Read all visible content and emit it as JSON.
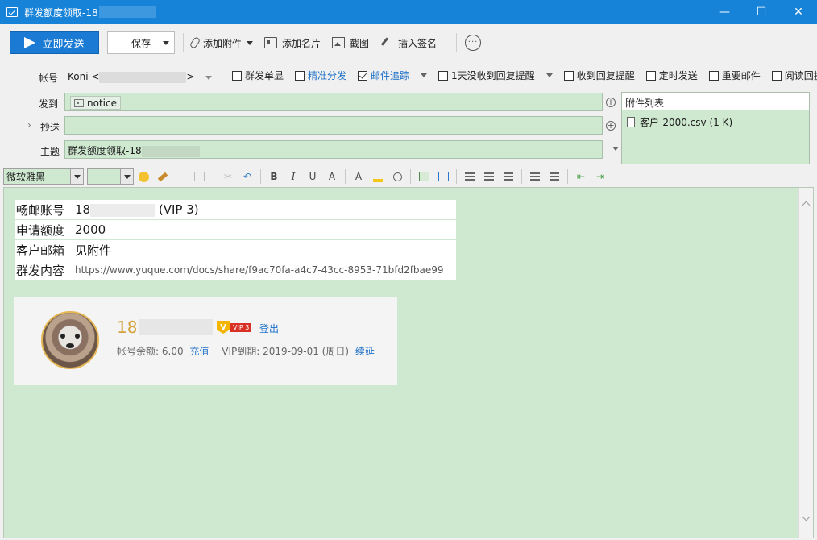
{
  "window": {
    "title": "群发额度领取-18",
    "minimize": "—",
    "maximize": "☐",
    "close": "✕"
  },
  "toolbar": {
    "send_label": "立即发送",
    "save_label": "保存",
    "attach_label": "添加附件",
    "card_label": "添加名片",
    "screenshot_label": "截图",
    "signature_label": "插入签名",
    "more_label": "···"
  },
  "header": {
    "account_label": "帐号",
    "account_value": "Koni <",
    "account_end": ">",
    "options": [
      {
        "label": "群发单显",
        "checked": false,
        "highlight": false
      },
      {
        "label": "精准分发",
        "checked": false,
        "highlight": true
      },
      {
        "label": "邮件追踪",
        "checked": true,
        "highlight": true
      },
      {
        "label": "1天没收到回复提醒",
        "checked": false,
        "highlight": false
      },
      {
        "label": "收到回复提醒",
        "checked": false,
        "highlight": false
      },
      {
        "label": "定时发送",
        "checked": false,
        "highlight": false
      },
      {
        "label": "重要邮件",
        "checked": false,
        "highlight": false
      },
      {
        "label": "阅读回执",
        "checked": false,
        "highlight": false
      }
    ],
    "to_label": "发到",
    "to_recipient": "notice",
    "cc_label": "抄送",
    "cc_expander": "›",
    "subject_label": "主题",
    "subject_value": "群发额度领取-18",
    "plus": "+"
  },
  "attachments": {
    "heading": "附件列表",
    "files": [
      "客户-2000.csv (1 K)"
    ]
  },
  "format": {
    "font_name": "微软雅黑",
    "font_size": "",
    "bold": "B",
    "italic": "I",
    "underline": "U",
    "strike": "A",
    "font_color": "A"
  },
  "body": {
    "rows": [
      {
        "key": "畅邮账号",
        "value_prefix": "18",
        "value_suffix": " (VIP 3)"
      },
      {
        "key": "申请额度",
        "value": "2000"
      },
      {
        "key": "客户邮箱",
        "value": "见附件"
      },
      {
        "key": "群发内容",
        "value": "https://www.yuque.com/docs/share/f9ac70fa-a4c7-43cc-8953-71bfd2fbae99"
      }
    ],
    "card": {
      "username": "18",
      "vip_v": "V",
      "vip_level": "VIP 3",
      "logout": "登出",
      "balance_label": "帐号余额:",
      "balance_value": "6.00",
      "recharge": "充值",
      "expiry_label": "VIP到期:",
      "expiry_value": "2019-09-01 (周日)",
      "renew": "续延"
    }
  },
  "colors": {
    "titlebar": "#1682d8",
    "send_button": "#1b7bd4",
    "field_bg": "#cfe8d0",
    "link": "#1b6fc8",
    "username": "#d4a23c"
  }
}
